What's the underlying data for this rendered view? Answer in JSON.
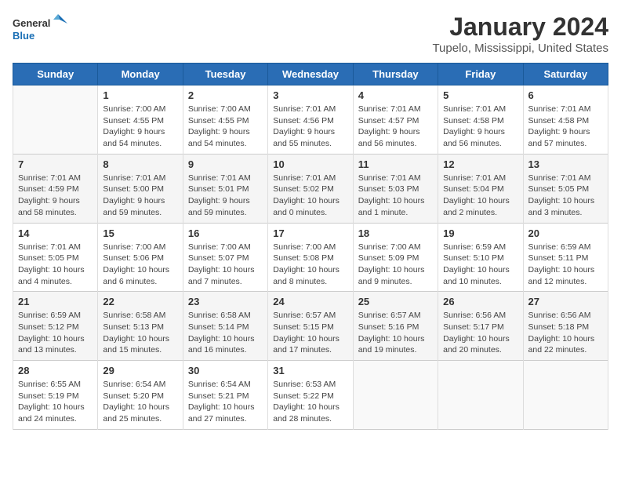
{
  "header": {
    "logo_general": "General",
    "logo_blue": "Blue",
    "month_title": "January 2024",
    "location": "Tupelo, Mississippi, United States"
  },
  "days_of_week": [
    "Sunday",
    "Monday",
    "Tuesday",
    "Wednesday",
    "Thursday",
    "Friday",
    "Saturday"
  ],
  "weeks": [
    [
      {
        "day": "",
        "info": ""
      },
      {
        "day": "1",
        "info": "Sunrise: 7:00 AM\nSunset: 4:55 PM\nDaylight: 9 hours\nand 54 minutes."
      },
      {
        "day": "2",
        "info": "Sunrise: 7:00 AM\nSunset: 4:55 PM\nDaylight: 9 hours\nand 54 minutes."
      },
      {
        "day": "3",
        "info": "Sunrise: 7:01 AM\nSunset: 4:56 PM\nDaylight: 9 hours\nand 55 minutes."
      },
      {
        "day": "4",
        "info": "Sunrise: 7:01 AM\nSunset: 4:57 PM\nDaylight: 9 hours\nand 56 minutes."
      },
      {
        "day": "5",
        "info": "Sunrise: 7:01 AM\nSunset: 4:58 PM\nDaylight: 9 hours\nand 56 minutes."
      },
      {
        "day": "6",
        "info": "Sunrise: 7:01 AM\nSunset: 4:58 PM\nDaylight: 9 hours\nand 57 minutes."
      }
    ],
    [
      {
        "day": "7",
        "info": "Sunrise: 7:01 AM\nSunset: 4:59 PM\nDaylight: 9 hours\nand 58 minutes."
      },
      {
        "day": "8",
        "info": "Sunrise: 7:01 AM\nSunset: 5:00 PM\nDaylight: 9 hours\nand 59 minutes."
      },
      {
        "day": "9",
        "info": "Sunrise: 7:01 AM\nSunset: 5:01 PM\nDaylight: 9 hours\nand 59 minutes."
      },
      {
        "day": "10",
        "info": "Sunrise: 7:01 AM\nSunset: 5:02 PM\nDaylight: 10 hours\nand 0 minutes."
      },
      {
        "day": "11",
        "info": "Sunrise: 7:01 AM\nSunset: 5:03 PM\nDaylight: 10 hours\nand 1 minute."
      },
      {
        "day": "12",
        "info": "Sunrise: 7:01 AM\nSunset: 5:04 PM\nDaylight: 10 hours\nand 2 minutes."
      },
      {
        "day": "13",
        "info": "Sunrise: 7:01 AM\nSunset: 5:05 PM\nDaylight: 10 hours\nand 3 minutes."
      }
    ],
    [
      {
        "day": "14",
        "info": "Sunrise: 7:01 AM\nSunset: 5:05 PM\nDaylight: 10 hours\nand 4 minutes."
      },
      {
        "day": "15",
        "info": "Sunrise: 7:00 AM\nSunset: 5:06 PM\nDaylight: 10 hours\nand 6 minutes."
      },
      {
        "day": "16",
        "info": "Sunrise: 7:00 AM\nSunset: 5:07 PM\nDaylight: 10 hours\nand 7 minutes."
      },
      {
        "day": "17",
        "info": "Sunrise: 7:00 AM\nSunset: 5:08 PM\nDaylight: 10 hours\nand 8 minutes."
      },
      {
        "day": "18",
        "info": "Sunrise: 7:00 AM\nSunset: 5:09 PM\nDaylight: 10 hours\nand 9 minutes."
      },
      {
        "day": "19",
        "info": "Sunrise: 6:59 AM\nSunset: 5:10 PM\nDaylight: 10 hours\nand 10 minutes."
      },
      {
        "day": "20",
        "info": "Sunrise: 6:59 AM\nSunset: 5:11 PM\nDaylight: 10 hours\nand 12 minutes."
      }
    ],
    [
      {
        "day": "21",
        "info": "Sunrise: 6:59 AM\nSunset: 5:12 PM\nDaylight: 10 hours\nand 13 minutes."
      },
      {
        "day": "22",
        "info": "Sunrise: 6:58 AM\nSunset: 5:13 PM\nDaylight: 10 hours\nand 15 minutes."
      },
      {
        "day": "23",
        "info": "Sunrise: 6:58 AM\nSunset: 5:14 PM\nDaylight: 10 hours\nand 16 minutes."
      },
      {
        "day": "24",
        "info": "Sunrise: 6:57 AM\nSunset: 5:15 PM\nDaylight: 10 hours\nand 17 minutes."
      },
      {
        "day": "25",
        "info": "Sunrise: 6:57 AM\nSunset: 5:16 PM\nDaylight: 10 hours\nand 19 minutes."
      },
      {
        "day": "26",
        "info": "Sunrise: 6:56 AM\nSunset: 5:17 PM\nDaylight: 10 hours\nand 20 minutes."
      },
      {
        "day": "27",
        "info": "Sunrise: 6:56 AM\nSunset: 5:18 PM\nDaylight: 10 hours\nand 22 minutes."
      }
    ],
    [
      {
        "day": "28",
        "info": "Sunrise: 6:55 AM\nSunset: 5:19 PM\nDaylight: 10 hours\nand 24 minutes."
      },
      {
        "day": "29",
        "info": "Sunrise: 6:54 AM\nSunset: 5:20 PM\nDaylight: 10 hours\nand 25 minutes."
      },
      {
        "day": "30",
        "info": "Sunrise: 6:54 AM\nSunset: 5:21 PM\nDaylight: 10 hours\nand 27 minutes."
      },
      {
        "day": "31",
        "info": "Sunrise: 6:53 AM\nSunset: 5:22 PM\nDaylight: 10 hours\nand 28 minutes."
      },
      {
        "day": "",
        "info": ""
      },
      {
        "day": "",
        "info": ""
      },
      {
        "day": "",
        "info": ""
      }
    ]
  ]
}
